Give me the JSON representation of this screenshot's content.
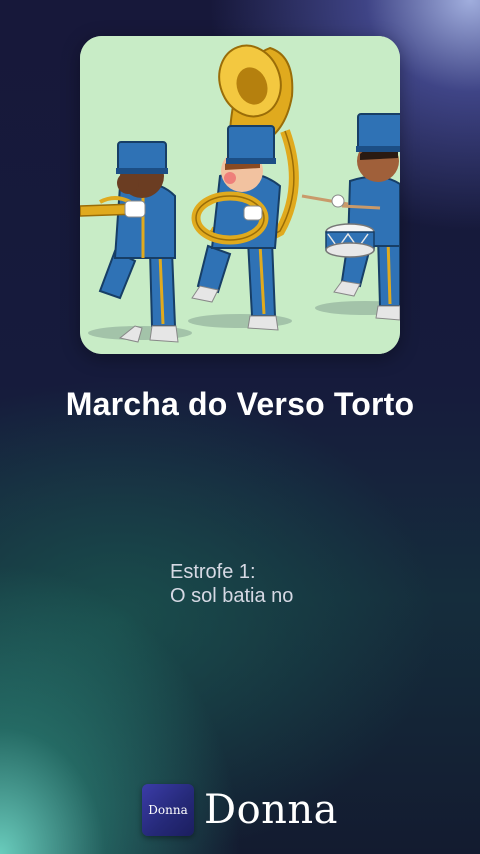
{
  "song": {
    "title": "Marcha do Verso Torto",
    "artwork": "marching-band-illustration"
  },
  "lyrics": {
    "line1": "Estrofe 1:",
    "line2": "O sol batia no"
  },
  "brand": {
    "logo_text": "Donna",
    "name": "Donna"
  },
  "colors": {
    "artwork_bg": "#c8ecc6",
    "uniform_blue": "#2f72b5",
    "brass_gold": "#e0aa1e"
  }
}
